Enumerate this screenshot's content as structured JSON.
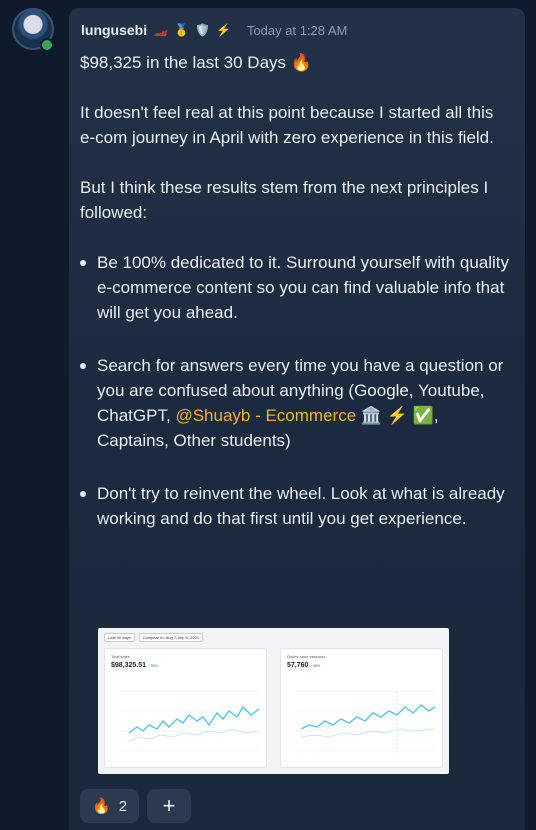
{
  "message": {
    "username": "lungusebi",
    "badges": [
      "🏎️",
      "🥇",
      "🛡️",
      "⚡"
    ],
    "timestamp": "Today at 1:28 AM",
    "headline": "$98,325 in the last 30 Days 🔥",
    "para1": "It doesn't feel real at this point because I started all this e-com journey in April with zero experience in this field.",
    "para2": "But I think these results stem from the next principles I followed:",
    "bullet1": "Be 100% dedicated to it. Surround yourself with quality e-commerce content so you can find valuable info that will get you ahead.",
    "bullet2_before": "Search for answers every time you have a question or you are confused about anything (Google, Youtube, ChatGPT,",
    "bullet2_mention": "@Shuayb - Ecommerce 🏛️ ⚡ ✅",
    "bullet2_after": ", Captains, Other students)",
    "bullet3": "Don't try to reinvent the wheel. Look at what is already working and do that first until you get experience."
  },
  "screenshot": {
    "filter_1": "Last 30 days",
    "filter_2": "Compare to: Aug 7-Sep 5, 2024",
    "panel_left": {
      "title": "Total sales",
      "value": "$98,325.51",
      "delta": "↑ 99%"
    },
    "panel_right": {
      "title": "Online store sessions",
      "value": "57,760",
      "delta": "↑ 98%"
    }
  },
  "reactions": {
    "fire_emoji": "🔥",
    "fire_count": "2",
    "add_label": "+"
  },
  "colors": {
    "card_bg": "#233146",
    "mention": "#f0b232",
    "chart_line": "#5bc0eb"
  }
}
